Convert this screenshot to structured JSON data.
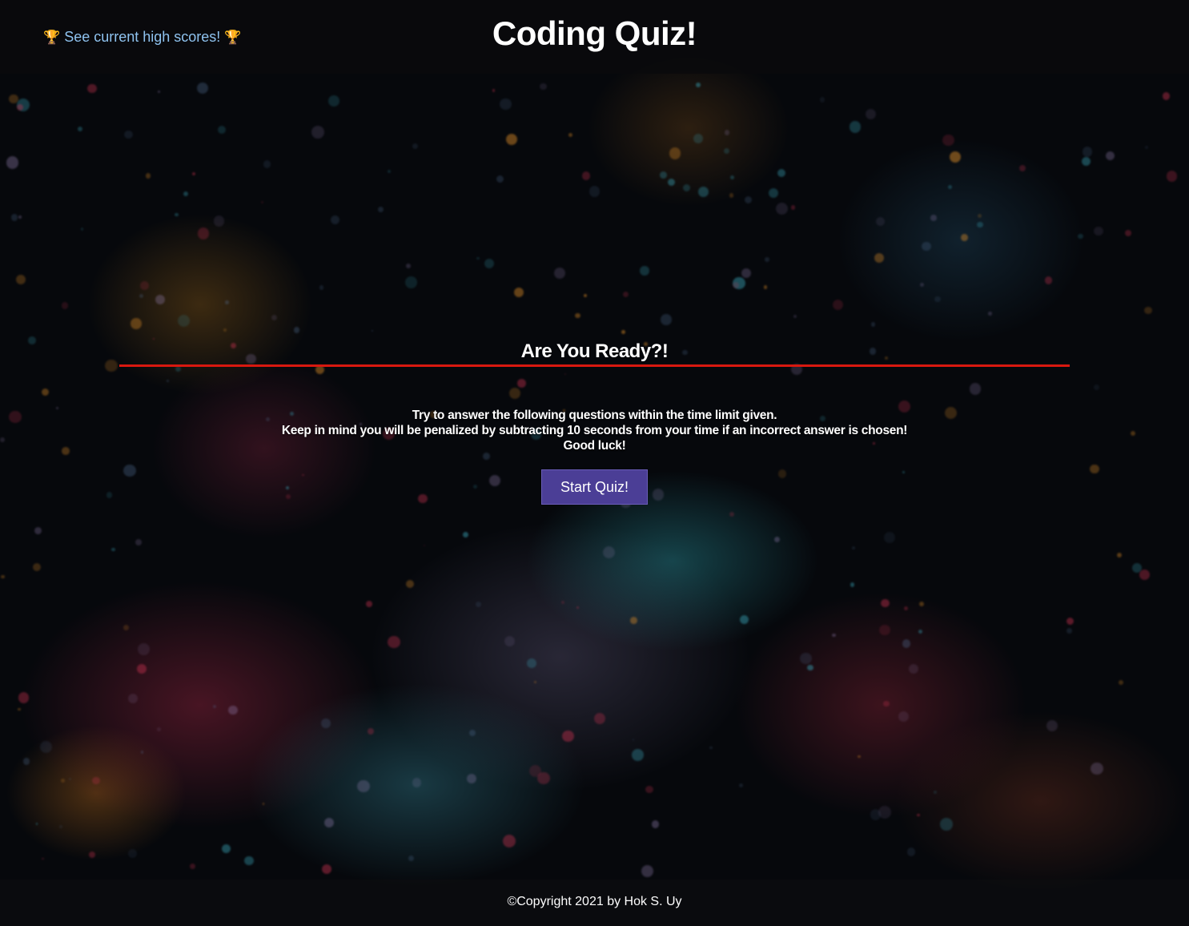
{
  "header": {
    "high_scores_link": "See current high scores!",
    "trophy_icon": "🏆",
    "title": "Coding Quiz!"
  },
  "intro": {
    "heading": "Are You Ready?!",
    "instructions": [
      "Try to answer the following questions within the time limit given.",
      "Keep in mind you will be penalized by subtracting 10 seconds from your time if an incorrect answer is chosen!",
      "Good luck!"
    ],
    "start_button": "Start Quiz!"
  },
  "footer": {
    "copyright": "©Copyright 2021 by Hok S. Uy"
  },
  "colors": {
    "accent_rule": "#d8180f",
    "button_bg": "#4b3e96",
    "link": "#8fc3f0",
    "trophy": "#f3b91c"
  }
}
